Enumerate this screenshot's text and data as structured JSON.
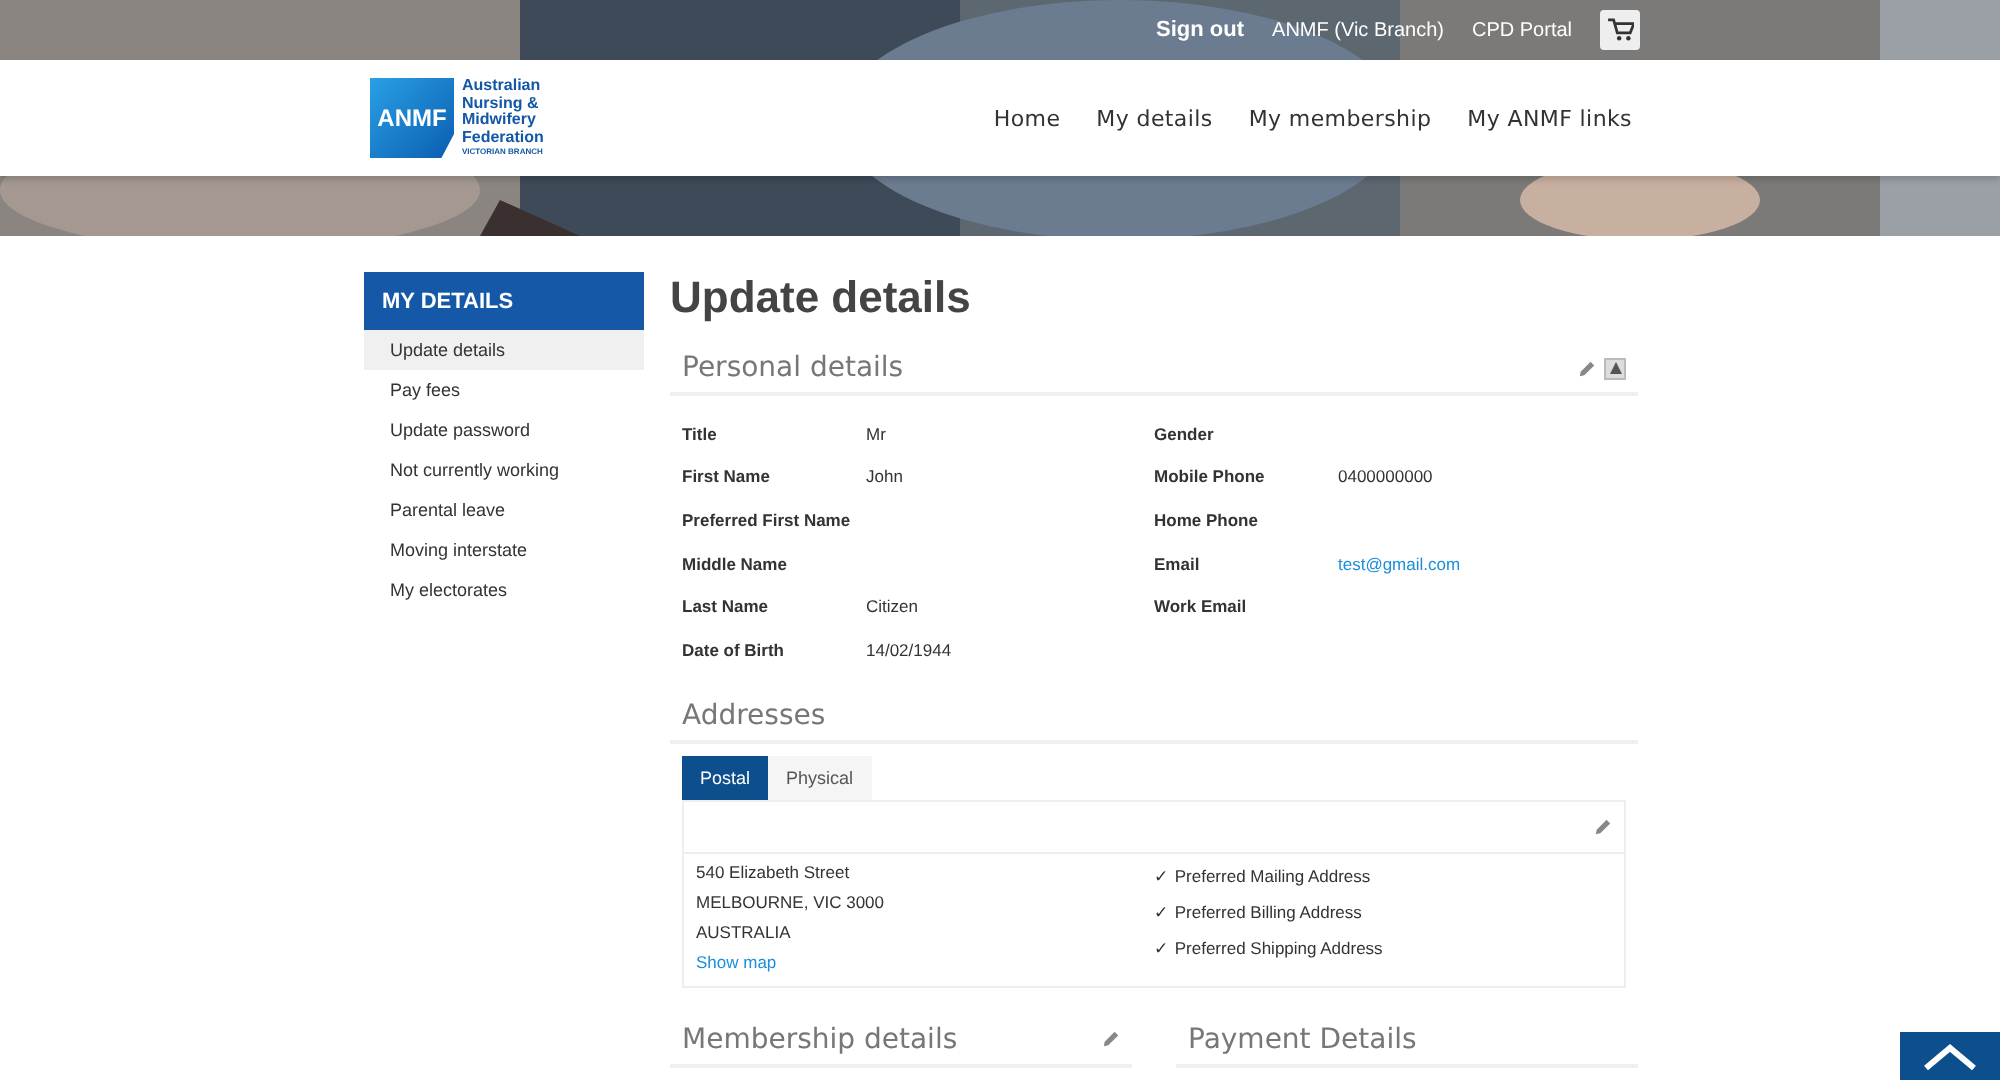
{
  "topbar": {
    "links": [
      {
        "label": "Sign out",
        "kind": "bold"
      },
      {
        "label": "ANMF (Vic Branch)",
        "kind": "plain"
      },
      {
        "label": "CPD Portal",
        "kind": "plain"
      }
    ]
  },
  "logo": {
    "mark": "ANMF",
    "lines": [
      "Australian",
      "Nursing &",
      "Midwifery",
      "Federation"
    ],
    "sub": "VICTORIAN BRANCH"
  },
  "nav": [
    {
      "label": "Home"
    },
    {
      "label": "My details"
    },
    {
      "label": "My membership"
    },
    {
      "label": "My ANMF links"
    }
  ],
  "sidebar": {
    "title": "MY DETAILS",
    "items": [
      {
        "label": "Update details",
        "selected": true
      },
      {
        "label": "Pay fees",
        "selected": false
      },
      {
        "label": "Update password",
        "selected": false
      },
      {
        "label": "Not currently working",
        "selected": false
      },
      {
        "label": "Parental leave",
        "selected": false
      },
      {
        "label": "Moving interstate",
        "selected": false
      },
      {
        "label": "My electorates",
        "selected": false
      }
    ]
  },
  "page_title": "Update details",
  "personal": {
    "title": "Personal details",
    "left": [
      {
        "label": "Title",
        "value": "Mr"
      },
      {
        "label": "First Name",
        "value": "John"
      },
      {
        "label": "Preferred First Name"
      },
      {
        "label": "Middle Name"
      },
      {
        "label": "Last Name",
        "value": "Citizen"
      },
      {
        "label": "Date of Birth",
        "value": "14/02/1944"
      }
    ],
    "right": [
      {
        "label": "Gender"
      },
      {
        "label": "Mobile Phone",
        "value": "0400000000"
      },
      {
        "label": "Home Phone"
      },
      {
        "label": "Email",
        "value": "test@gmail.com",
        "kind": "link"
      },
      {
        "label": "Work Email"
      }
    ]
  },
  "addresses": {
    "title": "Addresses",
    "tabs": [
      {
        "label": "Postal",
        "selected": true
      },
      {
        "label": "Physical",
        "selected": false
      }
    ],
    "lines": [
      "540 Elizabeth Street",
      "MELBOURNE, VIC 3000",
      "AUSTRALIA"
    ],
    "link": "Show map",
    "prefs": [
      "✓ Preferred Mailing Address",
      "✓ Preferred Billing Address",
      "✓ Preferred Shipping Address"
    ]
  },
  "bottom_sections": [
    {
      "title": "Membership details",
      "editable": true
    },
    {
      "title": "Payment Details",
      "editable": false
    }
  ]
}
